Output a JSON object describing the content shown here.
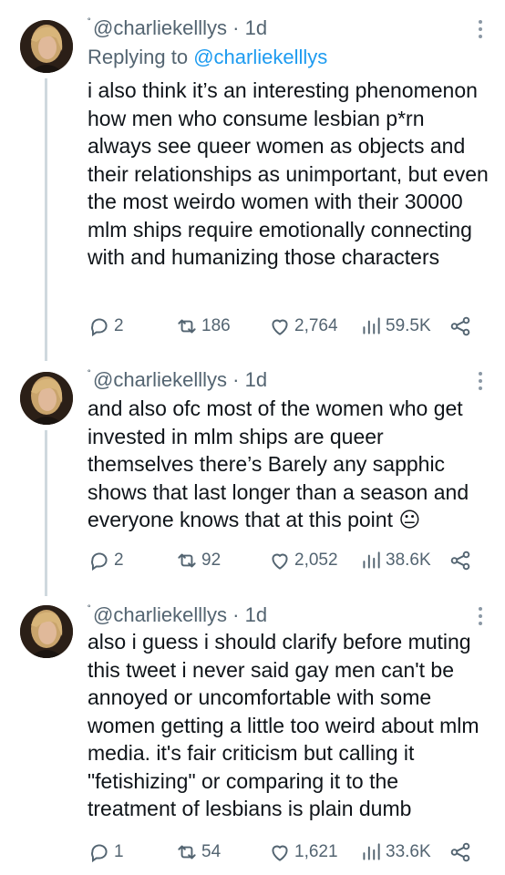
{
  "tweets": [
    {
      "handle": "@charliekelllys",
      "time": "1d",
      "reply_prefix": "Replying to",
      "reply_handle": "@charliekelllys",
      "text": "i also think it’s an interesting phenomenon how men who consume lesbian p*rn always see queer women as objects and their relationships as unimportant, but even the most weirdo women with their 30000 mlm ships require emotionally connecting with and humanizing those characters",
      "replies": "2",
      "retweets": "186",
      "likes": "2,764",
      "views": "59.5K"
    },
    {
      "handle": "@charliekelllys",
      "time": "1d",
      "text": "and also ofc most of the women who get invested in mlm ships are queer themselves there’s Barely any sapphic shows that last longer than a season and everyone knows that at this point 😐",
      "replies": "2",
      "retweets": "92",
      "likes": "2,052",
      "views": "38.6K"
    },
    {
      "handle": "@charliekelllys",
      "time": "1d",
      "text": "also i guess i should clarify before muting this tweet i never said gay men can't be annoyed or uncomfortable with some women getting a little too weird about mlm media. it's fair criticism but calling it \"fetishizing\" or comparing it to the treatment of lesbians is plain dumb",
      "replies": "1",
      "retweets": "54",
      "likes": "1,621",
      "views": "33.6K"
    }
  ],
  "separator": "·",
  "colors": {
    "text": "#0f1419",
    "secondary": "#536471",
    "link": "#1d9bf0",
    "thread_line": "#cfd9de"
  },
  "icons": [
    "avatar",
    "more-icon",
    "reply-icon",
    "retweet-icon",
    "like-icon",
    "views-icon",
    "share-icon"
  ]
}
